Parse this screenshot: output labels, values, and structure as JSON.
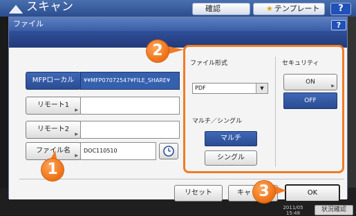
{
  "background_screen": {
    "title": "スキャン",
    "confirm_button": "確認",
    "template_button": "テンプレート",
    "help_button": "?",
    "status_button": "状況確認"
  },
  "dialog": {
    "title": "ファイル",
    "help_button": "?"
  },
  "destinations": [
    {
      "button_label": "MFPローカル",
      "value": "¥¥MFP07072547¥FILE_SHARE¥",
      "selected": true
    },
    {
      "button_label": "リモート1",
      "value": "",
      "selected": false
    },
    {
      "button_label": "リモート2",
      "value": "",
      "selected": false
    }
  ],
  "file_name": {
    "button_label": "ファイル名",
    "value": "DOC110510",
    "clock_icon": "clock-icon"
  },
  "settings": {
    "file_format_label": "ファイル形式",
    "file_format_value": "PDF",
    "multi_single_label": "マルチ／シングル",
    "multi_label": "マルチ",
    "single_label": "シングル",
    "multi_selected": true,
    "security_label": "セキュリティ",
    "security_on_label": "ON",
    "security_off_label": "OFF",
    "security_selected": "OFF",
    "highlight_color": "#f07b25"
  },
  "footer": {
    "reset_label": "リセット",
    "cancel_label": "キャ",
    "ok_label": "OK"
  },
  "callouts": {
    "marker_1": "1",
    "marker_2": "2",
    "marker_3": "3"
  }
}
